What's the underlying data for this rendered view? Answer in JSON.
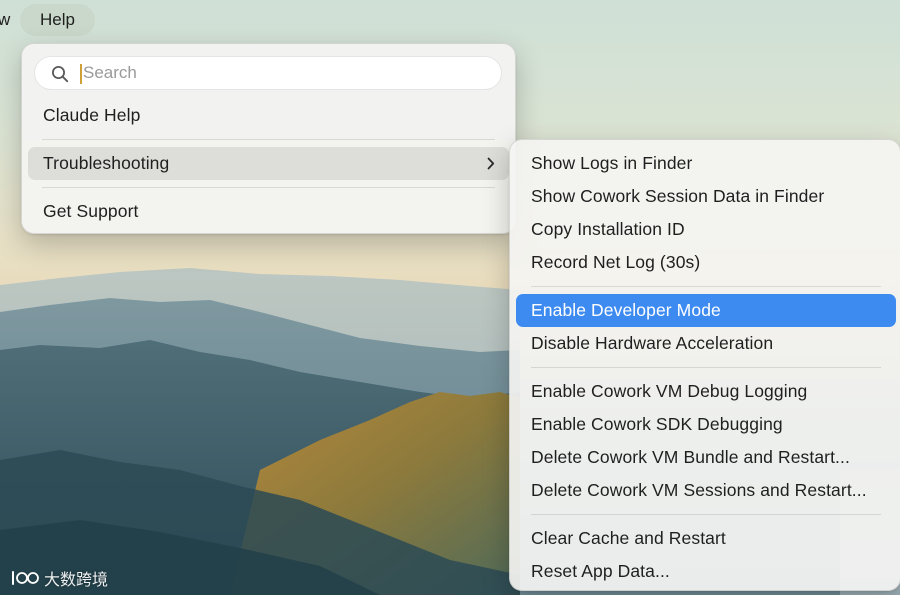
{
  "menubar": {
    "partial_label": "w",
    "help_label": "Help"
  },
  "help_menu": {
    "search": {
      "placeholder": "Search",
      "value": ""
    },
    "items": [
      {
        "label": "Claude Help"
      },
      {
        "label": "Troubleshooting",
        "has_submenu": true,
        "highlighted": true
      },
      {
        "label": "Get Support"
      }
    ]
  },
  "troubleshooting_menu": {
    "groups": [
      {
        "items": [
          {
            "label": "Show Logs in Finder"
          },
          {
            "label": "Show Cowork Session Data in Finder"
          },
          {
            "label": "Copy Installation ID"
          },
          {
            "label": "Record Net Log (30s)"
          }
        ]
      },
      {
        "items": [
          {
            "label": "Enable Developer Mode",
            "selected": true
          },
          {
            "label": "Disable Hardware Acceleration"
          }
        ]
      },
      {
        "items": [
          {
            "label": "Enable Cowork VM Debug Logging"
          },
          {
            "label": "Enable Cowork SDK Debugging"
          },
          {
            "label": "Delete Cowork VM Bundle and Restart..."
          },
          {
            "label": "Delete Cowork VM Sessions and Restart..."
          }
        ]
      },
      {
        "items": [
          {
            "label": "Clear Cache and Restart"
          },
          {
            "label": "Reset App Data..."
          }
        ]
      }
    ]
  },
  "watermark": {
    "text": "大数跨境"
  },
  "colors": {
    "selection": "#3d8bf0",
    "menu_background": "#f4f4f2",
    "text": "#1f1f1f",
    "caret": "#d0a038"
  },
  "icons": {
    "search": "search-icon",
    "submenu": "chevron-right-icon",
    "watermark_logo": "watermark-logo-icon"
  }
}
